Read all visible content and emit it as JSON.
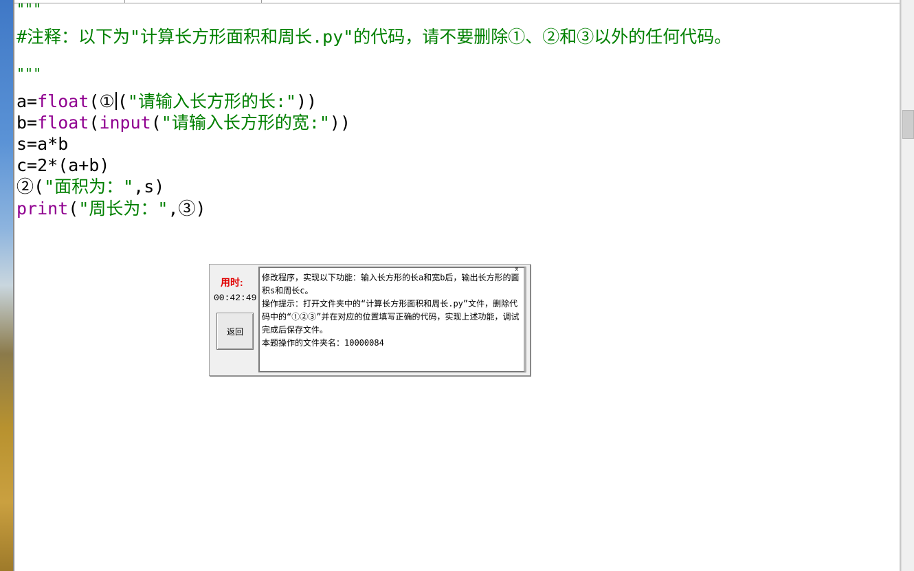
{
  "editor": {
    "lines": {
      "doc_open": "\"\"\"",
      "comment": "#注释：以下为\"计算长方形面积和周长.py\"的代码，请不要删除①、②和③以外的任何代码。",
      "doc_close": "\"\"\"",
      "l1_a": "a=",
      "l1_fn": "float",
      "l1_b": "(①",
      "l1_c": "(",
      "l1_str": "\"请输入长方形的长:\"",
      "l1_end": "))",
      "l2_a": "b=",
      "l2_fn": "float",
      "l2_b": "(",
      "l2_fn2": "input",
      "l2_c": "(",
      "l2_str": "\"请输入长方形的宽:\"",
      "l2_end": "))",
      "l3": "s=a*b",
      "l4": "c=2*(a+b)",
      "l5_a": "②(",
      "l5_str": "\"面积为：\"",
      "l5_end": ",s)",
      "l6_fn": "print",
      "l6_a": "(",
      "l6_str": "\"周长为：\"",
      "l6_end": ",③)"
    }
  },
  "dialog": {
    "timer_label": "用时:",
    "timer_value": "00:42:49",
    "back_button": "返回",
    "instructions": "修改程序，实现以下功能：输入长方形的长a和宽b后，输出长方形的面积s和周长c。\n操作提示：打开文件夹中的“计算长方形面积和周长.py”文件，删除代码中的“①②③”并在对应的位置填写正确的代码，实现上述功能，调试完成后保存文件。\n本题操作的文件夹名：10000084"
  },
  "colors": {
    "keyword": "#900090",
    "string": "#008000",
    "timer_label": "#e00000"
  }
}
